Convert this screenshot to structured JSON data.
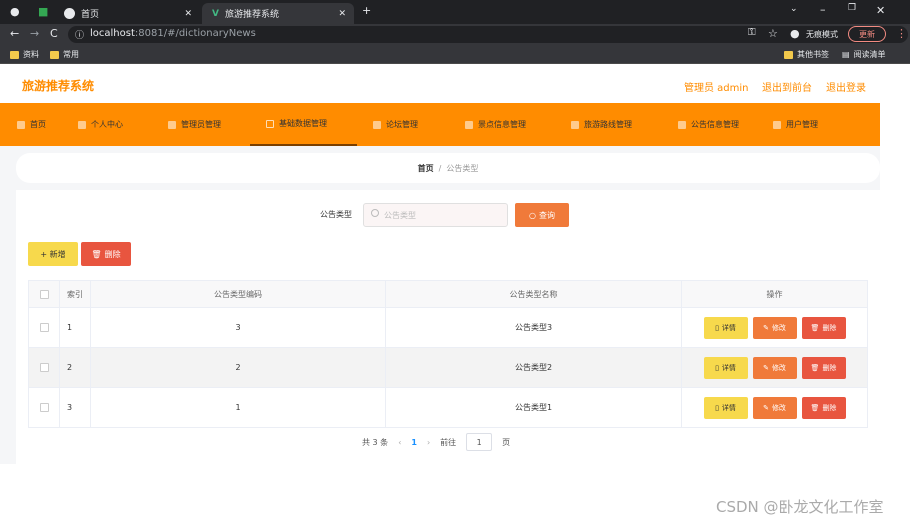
{
  "browser": {
    "tabs": [
      {
        "label": "首页"
      },
      {
        "label": "旅游推荐系统"
      }
    ],
    "url_host": "localhost",
    "url_path": ":8081/#/dictionaryNews",
    "incognito_label": "无痕模式",
    "update_label": "更新",
    "bookmarks": [
      "资料",
      "常用"
    ],
    "bookmarks_right": [
      "其他书签",
      "阅读清单"
    ]
  },
  "header": {
    "title": "旅游推荐系统",
    "admin_label": "管理员 admin",
    "back_label": "退出到前台",
    "logout_label": "退出登录"
  },
  "nav": {
    "items": [
      {
        "label": "首页"
      },
      {
        "label": "个人中心"
      },
      {
        "label": "管理员管理"
      },
      {
        "label": "基础数据管理"
      },
      {
        "label": "论坛管理"
      },
      {
        "label": "景点信息管理"
      },
      {
        "label": "旅游路线管理"
      },
      {
        "label": "公告信息管理"
      },
      {
        "label": "用户管理"
      }
    ],
    "active": "基础数据管理"
  },
  "breadcrumb": {
    "home": "首页",
    "sep": "/",
    "current": "公告类型"
  },
  "search": {
    "label": "公告类型",
    "placeholder": "公告类型",
    "button": "查询"
  },
  "actions": {
    "add": "+ 新增",
    "delete": "删除"
  },
  "table": {
    "headers": {
      "index": "索引",
      "code": "公告类型编码",
      "name": "公告类型名称",
      "op": "操作"
    },
    "rows": [
      {
        "index": "1",
        "code": "3",
        "name": "公告类型3"
      },
      {
        "index": "2",
        "code": "2",
        "name": "公告类型2"
      },
      {
        "index": "3",
        "code": "1",
        "name": "公告类型1"
      }
    ],
    "op_labels": {
      "detail": "详情",
      "edit": "修改",
      "delete": "删除"
    }
  },
  "pagination": {
    "total": "共 3 条",
    "current_page": "1",
    "goto_label": "前往",
    "goto_value": "1",
    "page_suffix": "页"
  },
  "watermark": "CSDN @卧龙文化工作室",
  "colors": {
    "accent": "#ff8c00",
    "query": "#f07a3a",
    "add": "#f7d94c",
    "danger": "#e8553f"
  }
}
